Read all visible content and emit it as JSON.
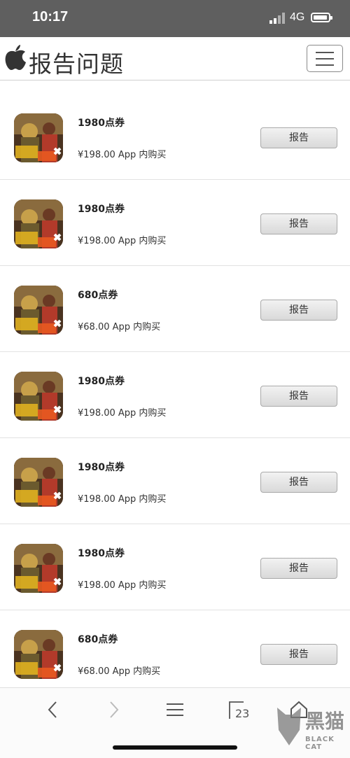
{
  "status_bar": {
    "time": "10:17",
    "network": "4G"
  },
  "header": {
    "title": "报告问题"
  },
  "items": [
    {
      "name": "1980点券",
      "price": "¥198.00 App 内购买",
      "button": "报告"
    },
    {
      "name": "1980点券",
      "price": "¥198.00 App 内购买",
      "button": "报告"
    },
    {
      "name": "680点券",
      "price": "¥68.00 App 内购买",
      "button": "报告"
    },
    {
      "name": "1980点券",
      "price": "¥198.00 App 内购买",
      "button": "报告"
    },
    {
      "name": "1980点券",
      "price": "¥198.00 App 内购买",
      "button": "报告"
    },
    {
      "name": "1980点券",
      "price": "¥198.00 App 内购买",
      "button": "报告"
    },
    {
      "name": "680点券",
      "price": "¥68.00 App 内购买",
      "button": "报告"
    }
  ],
  "bottom_bar": {
    "tab_count": "23"
  },
  "watermark": {
    "text_cn": "黑猫",
    "text_en": "BLACK CAT"
  }
}
